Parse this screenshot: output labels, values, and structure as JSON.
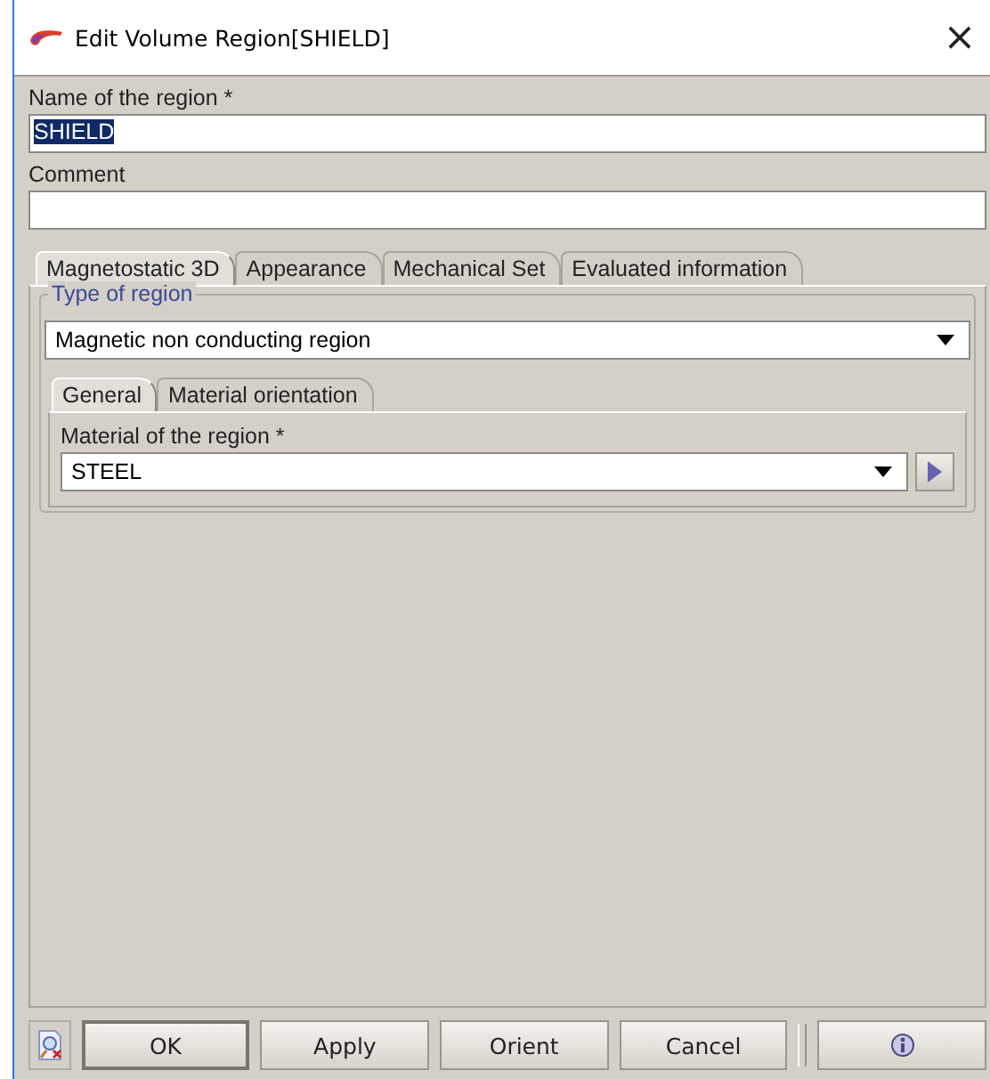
{
  "window": {
    "title": "Edit Volume Region[SHIELD]",
    "close": "×"
  },
  "name_field": {
    "label": "Name of the region *",
    "value": "SHIELD",
    "text_selected": true
  },
  "comment_field": {
    "label": "Comment"
  },
  "tabs": [
    {
      "label": "Magnetostatic 3D",
      "selected": true
    },
    {
      "label": "Appearance",
      "selected": false
    },
    {
      "label": "Mechanical Set",
      "selected": false
    },
    {
      "label": "Evaluated information",
      "selected": false
    }
  ],
  "type_group": {
    "legend": "Type of region",
    "value": "Magnetic non conducting region"
  },
  "subtabs": [
    {
      "label": "General",
      "selected": true
    },
    {
      "label": "Material orientation",
      "selected": false
    }
  ],
  "material_field": {
    "label": "Material of the region *",
    "value": "STEEL"
  },
  "buttons": [
    {
      "kind": "icon"
    },
    {
      "kind": "text",
      "label": "OK",
      "default": true
    },
    {
      "kind": "text",
      "label": "Apply",
      "default": false
    },
    {
      "kind": "text",
      "label": "Orient",
      "default": false
    },
    {
      "kind": "text",
      "label": "Cancel",
      "default": false
    },
    {
      "kind": "info"
    }
  ]
}
